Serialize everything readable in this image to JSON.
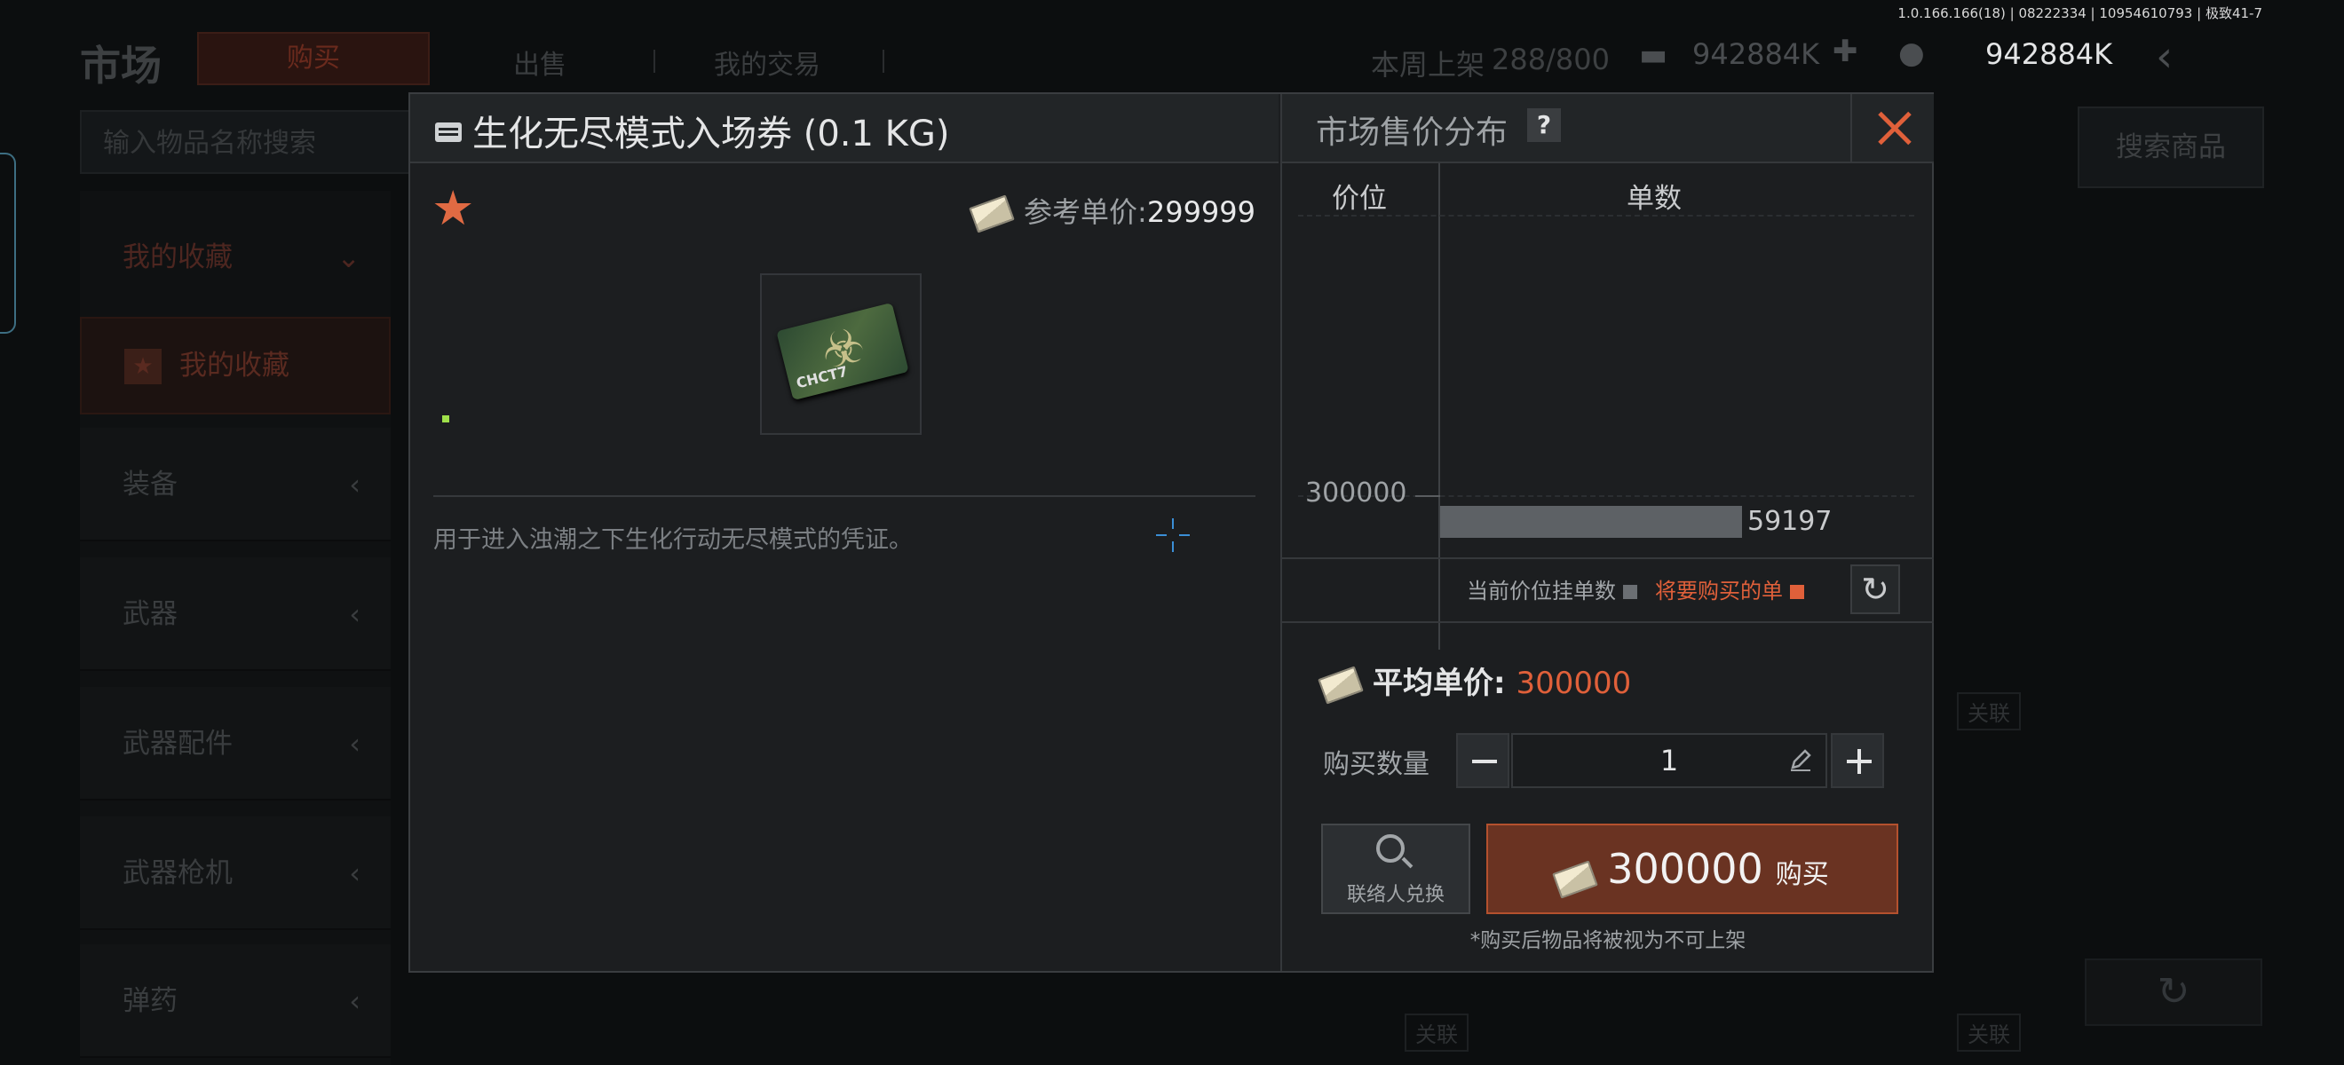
{
  "version": "1.0.166.166(18) | 08222334 | 10954610793 | 极致41-7",
  "background": {
    "title": "市场",
    "tabs": [
      "购买",
      "出售",
      "我的交易"
    ],
    "weekly_label": "本周上架",
    "weekly_value": "288/800",
    "money1": "942884K",
    "money2": "942884K",
    "search_placeholder": "输入物品名称搜索",
    "search_button": "搜索商品",
    "sidebar": {
      "header": "我的收藏",
      "favorite": "我的收藏",
      "items": [
        "装备",
        "武器",
        "武器配件",
        "武器枪机",
        "弹药"
      ]
    },
    "link_label": "关联"
  },
  "modal": {
    "item": {
      "title": "生化无尽模式入场券 (0.1 KG)",
      "ref_price_label": "参考单价:",
      "ref_price_value": "299999",
      "description": "用于进入浊潮之下生化行动无尽模式的凭证。",
      "card_tag": "CHCT7"
    },
    "distribution": {
      "title": "市场售价分布",
      "help": "?",
      "col_price": "价位",
      "col_count": "单数",
      "legend_current": "当前价位挂单数",
      "legend_buy": "将要购买的单",
      "colors": {
        "current": "#6b6f73",
        "buy": "#e0603a"
      }
    },
    "chart_data": {
      "type": "bar",
      "orientation": "horizontal",
      "categories": [
        "300000"
      ],
      "values": [
        59197
      ],
      "xlabel": "单数",
      "ylabel": "价位"
    },
    "purchase": {
      "avg_label": "平均单价:",
      "avg_value": "300000",
      "qty_label": "购买数量",
      "qty_value": "1",
      "contact_label": "联络人兑换",
      "buy_amount": "300000",
      "buy_label": "购买",
      "note": "*购买后物品将被视为不可上架"
    }
  }
}
